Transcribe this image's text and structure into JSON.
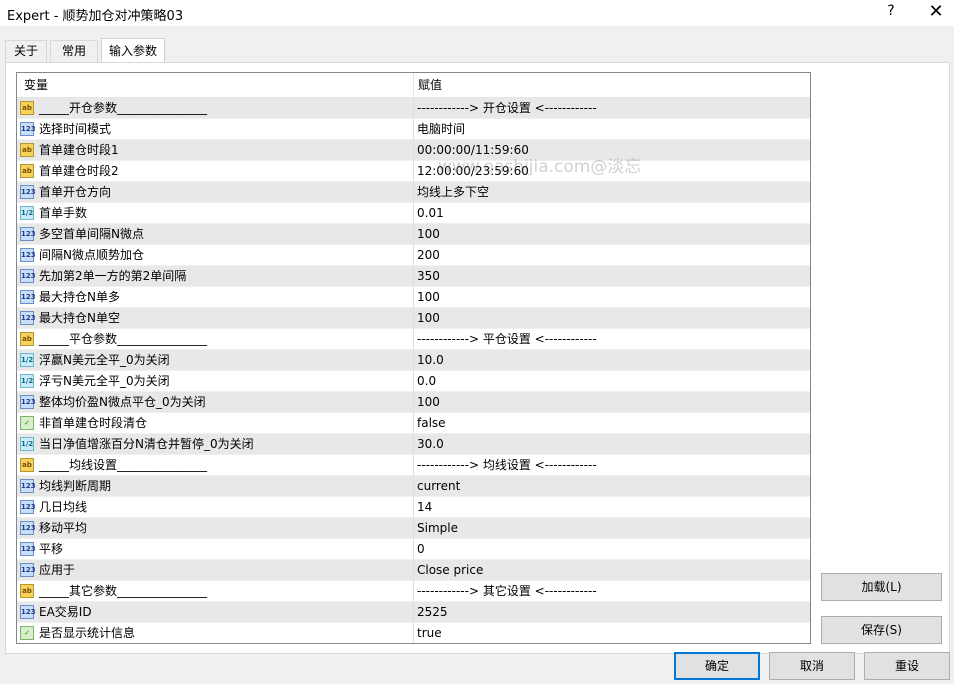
{
  "window": {
    "title": "Expert - 顺势加仓对冲策略03",
    "help": "?",
    "close": "✕"
  },
  "tabs": [
    {
      "label": "关于",
      "active": false
    },
    {
      "label": "常用",
      "active": false
    },
    {
      "label": "输入参数",
      "active": true
    }
  ],
  "grid": {
    "col_variable": "变量",
    "col_value": "赋值",
    "rows": [
      {
        "type": "ab",
        "name": "_____开仓参数_______________",
        "value": "------------> 开仓设置 <------------"
      },
      {
        "type": "num",
        "name": "选择时间模式",
        "value": "电脑时间"
      },
      {
        "type": "ab",
        "name": "首单建仓时段1",
        "value": "00:00:00/11:59:60"
      },
      {
        "type": "ab",
        "name": "首单建仓时段2",
        "value": "12:00:00/23:59:60"
      },
      {
        "type": "num",
        "name": "首单开仓方向",
        "value": "均线上多下空"
      },
      {
        "type": "dbl",
        "name": "首单手数",
        "value": "0.01"
      },
      {
        "type": "num",
        "name": "多空首单间隔N微点",
        "value": "100"
      },
      {
        "type": "num",
        "name": "间隔N微点顺势加仓",
        "value": "200"
      },
      {
        "type": "num",
        "name": "先加第2单一方的第2单间隔",
        "value": "350"
      },
      {
        "type": "num",
        "name": "最大持仓N单多",
        "value": "100"
      },
      {
        "type": "num",
        "name": "最大持仓N单空",
        "value": "100"
      },
      {
        "type": "ab",
        "name": "_____平仓参数_______________",
        "value": "------------> 平仓设置 <------------"
      },
      {
        "type": "dbl",
        "name": "浮赢N美元全平_0为关闭",
        "value": "10.0"
      },
      {
        "type": "dbl",
        "name": "浮亏N美元全平_0为关闭",
        "value": "0.0"
      },
      {
        "type": "num",
        "name": "整体均价盈N微点平仓_0为关闭",
        "value": "100"
      },
      {
        "type": "bool",
        "name": "非首单建仓时段清仓",
        "value": "false"
      },
      {
        "type": "dbl",
        "name": "当日净值增涨百分N清仓并暂停_0为关闭",
        "value": "30.0"
      },
      {
        "type": "ab",
        "name": "_____均线设置_______________",
        "value": "------------> 均线设置 <------------"
      },
      {
        "type": "num",
        "name": "均线判断周期",
        "value": "current"
      },
      {
        "type": "num",
        "name": "几日均线",
        "value": "14"
      },
      {
        "type": "num",
        "name": "移动平均",
        "value": "Simple"
      },
      {
        "type": "num",
        "name": "平移",
        "value": "0"
      },
      {
        "type": "num",
        "name": "应用于",
        "value": "Close price"
      },
      {
        "type": "ab",
        "name": "_____其它参数_______________",
        "value": "------------> 其它设置 <------------"
      },
      {
        "type": "num",
        "name": "EA交易ID",
        "value": "2525"
      },
      {
        "type": "bool",
        "name": "是否显示统计信息",
        "value": "true"
      }
    ]
  },
  "icon_labels": {
    "ab": "ab",
    "num": "123",
    "dbl": "1/2",
    "bool": "✓"
  },
  "watermark": "www.eashijia.com@淡忘",
  "buttons": {
    "load": "加载(L)",
    "save": "保存(S)",
    "ok": "确定",
    "cancel": "取消",
    "reset": "重设"
  }
}
